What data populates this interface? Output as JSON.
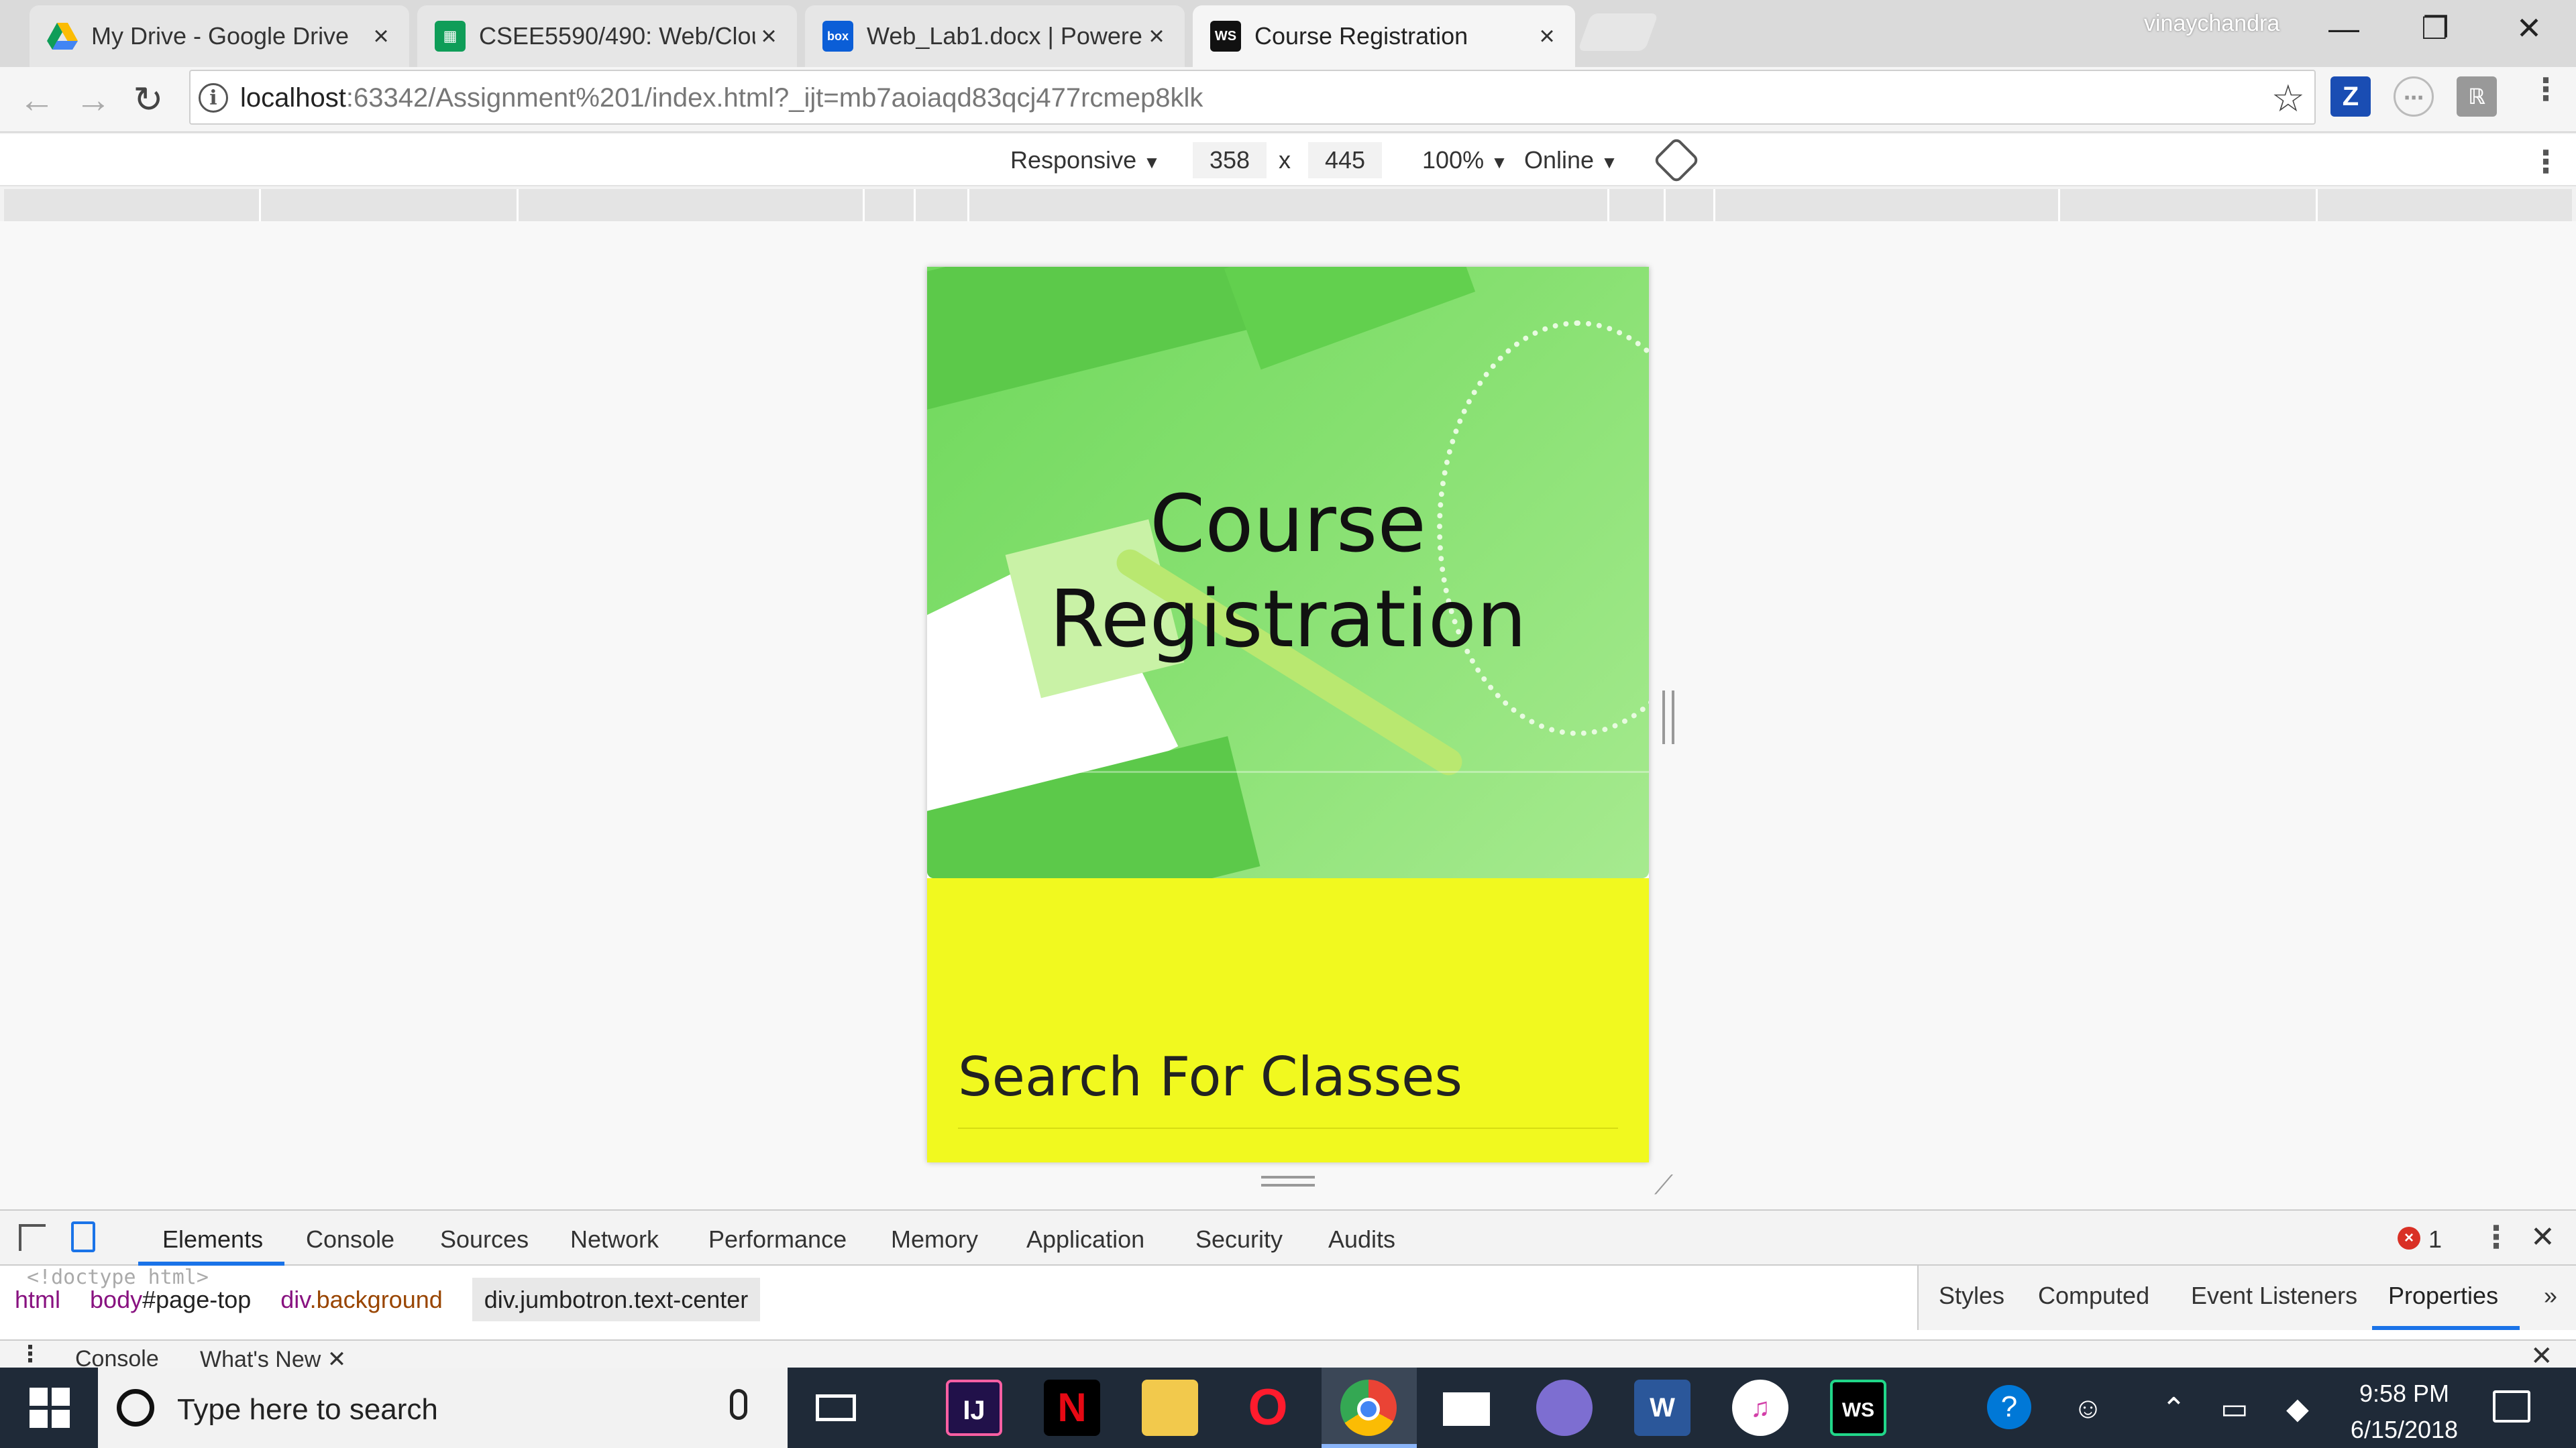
{
  "browser": {
    "tabs": [
      {
        "title": "My Drive - Google Drive",
        "favicon": "google-drive-icon",
        "active": false
      },
      {
        "title": "CSEE5590/490: Web/Clou",
        "favicon": "google-sheets-icon",
        "active": false
      },
      {
        "title": "Web_Lab1.docx | Powere",
        "favicon": "box-icon",
        "favicon_text": "box",
        "active": false
      },
      {
        "title": "Course Registration",
        "favicon": "webstorm-icon",
        "favicon_text": "WS",
        "active": true
      }
    ],
    "close_glyph": "×",
    "profile_name": "vinaychandra",
    "window": {
      "minimize": "—",
      "restore": "❐",
      "close": "✕"
    },
    "url_host": "localhost",
    "url_rest": ":63342/Assignment%201/index.html?_ijt=mb7aoiaqd83qcj477rcmep8klk",
    "extensions": [
      "Z",
      "⋯",
      "ℝ"
    ]
  },
  "device_toolbar": {
    "mode": "Responsive",
    "width": "358",
    "times": "x",
    "height": "445",
    "zoom": "100%",
    "network": "Online",
    "caret": "▼"
  },
  "page": {
    "hero_title_line1": "Course",
    "hero_title_line2": "Registration",
    "search_heading": "Search For Classes",
    "colors": {
      "hero_green": "#7bdc66",
      "panel_yellow": "#f1f91f"
    }
  },
  "devtools": {
    "tabs": [
      "Elements",
      "Console",
      "Sources",
      "Network",
      "Performance",
      "Memory",
      "Application",
      "Security",
      "Audits"
    ],
    "active_tab": "Elements",
    "error_count": "1",
    "doctype_hint": "<!doctype html>",
    "breadcrumb": [
      {
        "tag": "html",
        "rest": ""
      },
      {
        "tag": "body",
        "rest": "#page-top"
      },
      {
        "tag": "div",
        "rest": ".background"
      },
      {
        "tag": "div",
        "rest": ".jumbotron.text-center"
      }
    ],
    "side_tabs": [
      "Styles",
      "Computed",
      "Event Listeners",
      "Properties"
    ],
    "active_side_tab": "Properties",
    "drawer_tabs": [
      "Console",
      "What's New"
    ]
  },
  "taskbar": {
    "search_placeholder": "Type here to search",
    "apps": [
      {
        "name": "intellij-icon",
        "label": "IJ"
      },
      {
        "name": "netflix-icon",
        "label": "N"
      },
      {
        "name": "file-explorer-icon",
        "label": ""
      },
      {
        "name": "opera-icon",
        "label": "O"
      },
      {
        "name": "chrome-icon",
        "label": ""
      },
      {
        "name": "mail-icon",
        "label": ""
      },
      {
        "name": "bittorrent-icon",
        "label": ""
      },
      {
        "name": "word-icon",
        "label": "W"
      },
      {
        "name": "itunes-icon",
        "label": "♫"
      },
      {
        "name": "webstorm-icon",
        "label": "WS"
      }
    ],
    "time": "9:58 PM",
    "date": "6/15/2018"
  }
}
